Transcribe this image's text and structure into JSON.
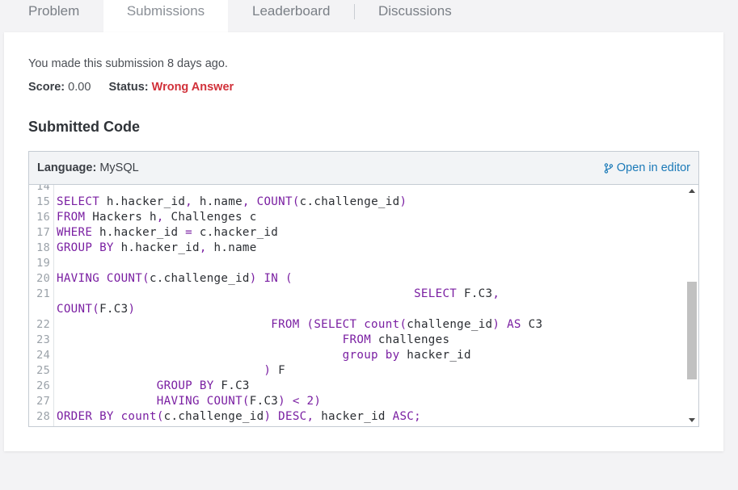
{
  "tabs": [
    {
      "label": "Problem"
    },
    {
      "label": "Submissions"
    },
    {
      "label": "Leaderboard"
    },
    {
      "label": "Discussions"
    }
  ],
  "submission": {
    "info": "You made this submission 8 days ago.",
    "score_label": "Score:",
    "score_value": "0.00",
    "status_label": "Status:",
    "status_value": "Wrong Answer",
    "status_color": "#d1313a"
  },
  "section_title": "Submitted Code",
  "code_panel": {
    "language_label": "Language:",
    "language_value": "MySQL",
    "open_editor_label": "Open in editor",
    "open_editor_icon": "branch-icon"
  },
  "code": {
    "line_numbers": [
      "14",
      "15",
      "16",
      "17",
      "18",
      "19",
      "20",
      "21",
      "",
      "22",
      "23",
      "24",
      "25",
      "26",
      "27",
      "28"
    ],
    "lines": [
      "",
      "SELECT h.hacker_id, h.name, COUNT(c.challenge_id)",
      "FROM Hackers h, Challenges c",
      "WHERE h.hacker_id = c.hacker_id",
      "GROUP BY h.hacker_id, h.name",
      "",
      "HAVING COUNT(c.challenge_id) IN (",
      "                                                  SELECT F.C3,",
      "COUNT(F.C3)",
      "                              FROM (SELECT count(challenge_id) AS C3",
      "                                        FROM challenges",
      "                                        group by hacker_id",
      "                             ) F",
      "              GROUP BY F.C3",
      "              HAVING COUNT(F.C3) < 2)",
      "ORDER BY count(c.challenge_id) DESC, hacker_id ASC;"
    ],
    "keyword_color": "#7a1fa2"
  }
}
